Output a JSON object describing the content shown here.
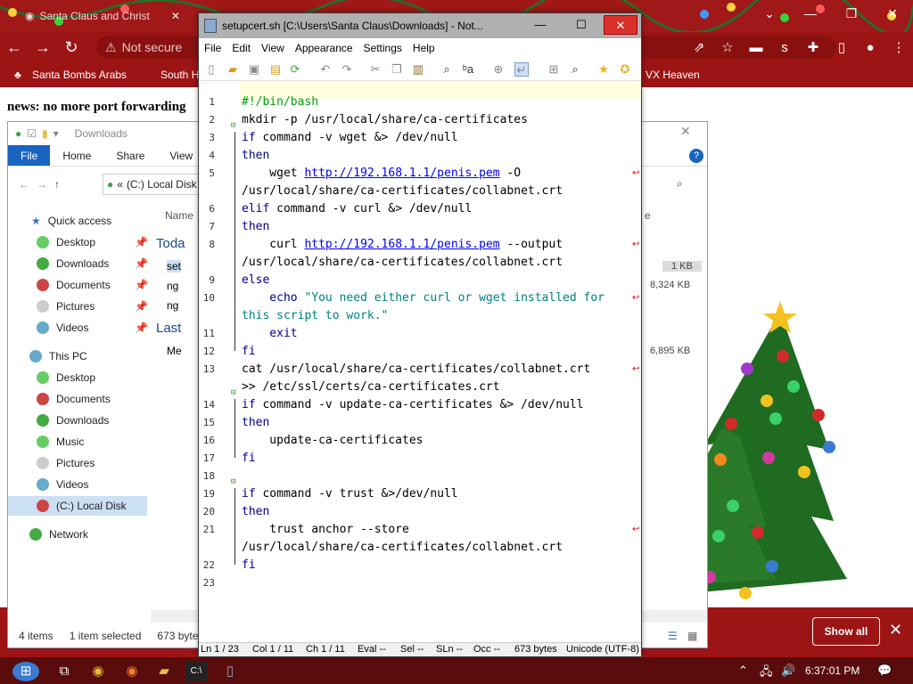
{
  "browser": {
    "tab_title": "Santa Claus and Christ",
    "address_text": "Not secure",
    "bookmarks": [
      "Santa Bombs Arabs",
      "South H",
      "VX Heaven"
    ]
  },
  "page": {
    "headline": "news: no more port forwarding"
  },
  "explorer": {
    "title": "Downloads",
    "ribbon_tabs": [
      "File",
      "Home",
      "Share",
      "View"
    ],
    "address": "(C:) Local Disk",
    "address_prefix": "«",
    "column_name": "Name",
    "column_size_abbrev": "e",
    "groups": [
      "Toda",
      "Last"
    ],
    "files": [
      "set",
      "ng",
      "ng",
      "Me"
    ],
    "sizes": [
      "1 KB",
      "8,324 KB",
      "6,895 KB"
    ],
    "nav": {
      "quick_access": "Quick access",
      "qa_items": [
        "Desktop",
        "Downloads",
        "Documents",
        "Pictures",
        "Videos"
      ],
      "this_pc": "This PC",
      "pc_items": [
        "Desktop",
        "Documents",
        "Downloads",
        "Music",
        "Pictures",
        "Videos",
        "(C:) Local Disk"
      ],
      "network": "Network"
    },
    "status": {
      "items": "4 items",
      "selected": "1 item selected",
      "size": "673 bytes"
    }
  },
  "notepad": {
    "title": "setupcert.sh [C:\\Users\\Santa Claus\\Downloads] - Not...",
    "menu": [
      "File",
      "Edit",
      "View",
      "Appearance",
      "Settings",
      "Help"
    ],
    "status": {
      "ln": "Ln  1 / 23",
      "col": "Col  1 / 11",
      "ch": "Ch  1 / 11",
      "eval": "Eval  --",
      "sel": "Sel  --",
      "sln": "SLn  --",
      "occ": "Occ  --",
      "bytes": "673 bytes",
      "encoding": "Unicode (UTF-8)"
    },
    "line_numbers": [
      "1",
      "2",
      "3",
      "4",
      "5",
      "6",
      "7",
      "8",
      "9",
      "10",
      "11",
      "12",
      "13",
      "14",
      "15",
      "16",
      "17",
      "18",
      "19",
      "20",
      "21",
      "22",
      "23"
    ],
    "code": {
      "l1": "#!/bin/bash",
      "l2": "mkdir -p /usr/local/share/ca-certificates",
      "l3_kw": "if",
      "l3": " command -v wget &> /dev/null",
      "l4": "then",
      "l5a": "    wget ",
      "l5url": "http://192.168.1.1/penis.pem",
      "l5b": " -O",
      "l5c": "/usr/local/share/ca-certificates/collabnet.crt",
      "l6_kw": "elif",
      "l6": " command -v curl &> /dev/null",
      "l7": "then",
      "l8a": "    curl ",
      "l8url": "http://192.168.1.1/penis.pem",
      "l8b": " --output",
      "l8c": "/usr/local/share/ca-certificates/collabnet.crt",
      "l9": "else",
      "l10a": "    echo ",
      "l10str": "\"You need either curl or wget installed for",
      "l10c": "this script to work.\"",
      "l11": "    exit",
      "l12": "fi",
      "l13a": "cat /usr/local/share/ca-certificates/collabnet.crt",
      "l13b": ">> /etc/ssl/certs/ca-certificates.crt",
      "l14_kw": "if",
      "l14": " command -v update-ca-certificates &> /dev/null",
      "l15": "then",
      "l16": "    update-ca-certificates",
      "l17": "fi",
      "l19_kw": "if",
      "l19": " command -v trust &>/dev/null",
      "l20": "then",
      "l21a": "    trust anchor --store",
      "l21b": "/usr/local/share/ca-certificates/collabnet.crt",
      "l22": "fi"
    }
  },
  "notification": {
    "show_all": "Show all"
  },
  "taskbar": {
    "time": "6:37:01 PM"
  },
  "colors": {
    "browser_red": "#9c1414",
    "keyword_blue": "#00008b",
    "url_blue": "#0000ee",
    "string_teal": "#008080",
    "comment_green": "#00a000"
  }
}
